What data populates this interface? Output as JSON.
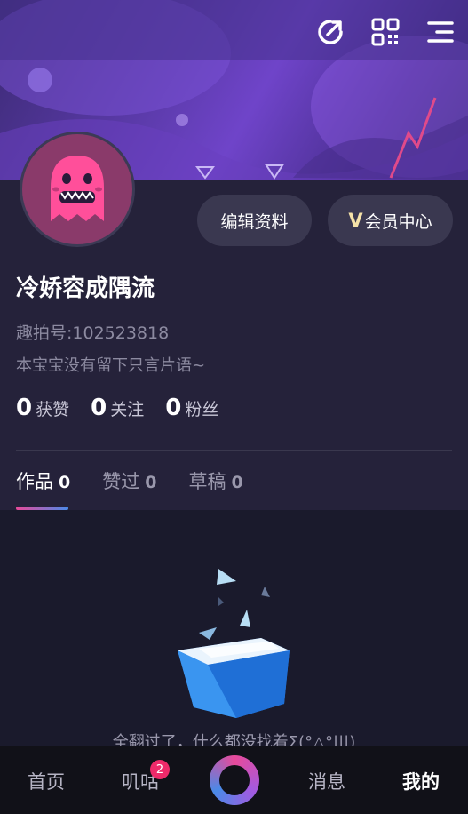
{
  "header": {
    "icons": [
      "share-icon",
      "qr-code-icon",
      "menu-icon"
    ]
  },
  "profile": {
    "edit_label": "编辑资料",
    "vip_label": "会员中心",
    "name": "冷娇容成隅流",
    "id_text": "趣拍号:102523818",
    "bio": "本宝宝没有留下只言片语~",
    "stats": [
      {
        "num": "0",
        "label": "获赞"
      },
      {
        "num": "0",
        "label": "关注"
      },
      {
        "num": "0",
        "label": "粉丝"
      }
    ]
  },
  "tabs": [
    {
      "label": "作品",
      "count": "0"
    },
    {
      "label": "赞过",
      "count": "0"
    },
    {
      "label": "草稿",
      "count": "0"
    }
  ],
  "empty": {
    "text": "全翻过了，什么都没找着Σ(°△°|||)"
  },
  "bottom_nav": {
    "home": "首页",
    "jigu": "叽咕",
    "jigu_badge": "2",
    "messages": "消息",
    "mine": "我的"
  },
  "colors": {
    "accent_pink": "#e84a9a",
    "accent_blue": "#4a8ae8",
    "badge_red": "#ef2a6a"
  }
}
